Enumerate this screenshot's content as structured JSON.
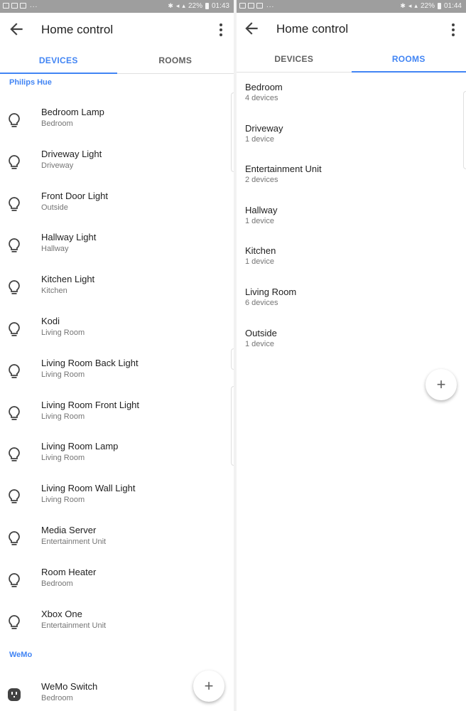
{
  "left": {
    "status": {
      "battery": "22%",
      "time": "01:43"
    },
    "app_title": "Home control",
    "tabs": [
      {
        "label": "DEVICES",
        "active": true
      },
      {
        "label": "ROOMS",
        "active": false
      }
    ],
    "sections": [
      {
        "header": "Philips Hue",
        "devices": [
          {
            "name": "Bedroom Lamp",
            "room": "Bedroom",
            "icon": "lightbulb-icon"
          },
          {
            "name": "Driveway Light",
            "room": "Driveway",
            "icon": "lightbulb-icon"
          },
          {
            "name": "Front Door Light",
            "room": "Outside",
            "icon": "lightbulb-icon"
          },
          {
            "name": "Hallway Light",
            "room": "Hallway",
            "icon": "lightbulb-icon"
          },
          {
            "name": "Kitchen Light",
            "room": "Kitchen",
            "icon": "lightbulb-icon"
          },
          {
            "name": "Kodi",
            "room": "Living Room",
            "icon": "lightbulb-icon"
          },
          {
            "name": "Living Room Back Light",
            "room": "Living Room",
            "icon": "lightbulb-icon"
          },
          {
            "name": "Living Room Front Light",
            "room": "Living Room",
            "icon": "lightbulb-icon"
          },
          {
            "name": "Living Room Lamp",
            "room": "Living Room",
            "icon": "lightbulb-icon"
          },
          {
            "name": "Living Room Wall Light",
            "room": "Living Room",
            "icon": "lightbulb-icon"
          },
          {
            "name": "Media Server",
            "room": "Entertainment Unit",
            "icon": "lightbulb-icon"
          },
          {
            "name": "Room Heater",
            "room": "Bedroom",
            "icon": "lightbulb-icon"
          },
          {
            "name": "Xbox One",
            "room": "Entertainment Unit",
            "icon": "lightbulb-icon"
          }
        ]
      },
      {
        "header": "WeMo",
        "devices": [
          {
            "name": "WeMo Switch",
            "room": "Bedroom",
            "icon": "outlet-icon"
          }
        ]
      }
    ],
    "fab_label": "+"
  },
  "right": {
    "status": {
      "battery": "22%",
      "time": "01:44"
    },
    "app_title": "Home control",
    "tabs": [
      {
        "label": "DEVICES",
        "active": false
      },
      {
        "label": "ROOMS",
        "active": true
      }
    ],
    "rooms": [
      {
        "name": "Bedroom",
        "count": "4 devices"
      },
      {
        "name": "Driveway",
        "count": "1 device"
      },
      {
        "name": "Entertainment Unit",
        "count": "2 devices"
      },
      {
        "name": "Hallway",
        "count": "1 device"
      },
      {
        "name": "Kitchen",
        "count": "1 device"
      },
      {
        "name": "Living Room",
        "count": "6 devices"
      },
      {
        "name": "Outside",
        "count": "1 device"
      }
    ],
    "fab_label": "+"
  },
  "colors": {
    "accent": "#4285f4",
    "status_bar": "#9e9e9e",
    "text_primary": "#212121",
    "text_secondary": "#757575"
  }
}
